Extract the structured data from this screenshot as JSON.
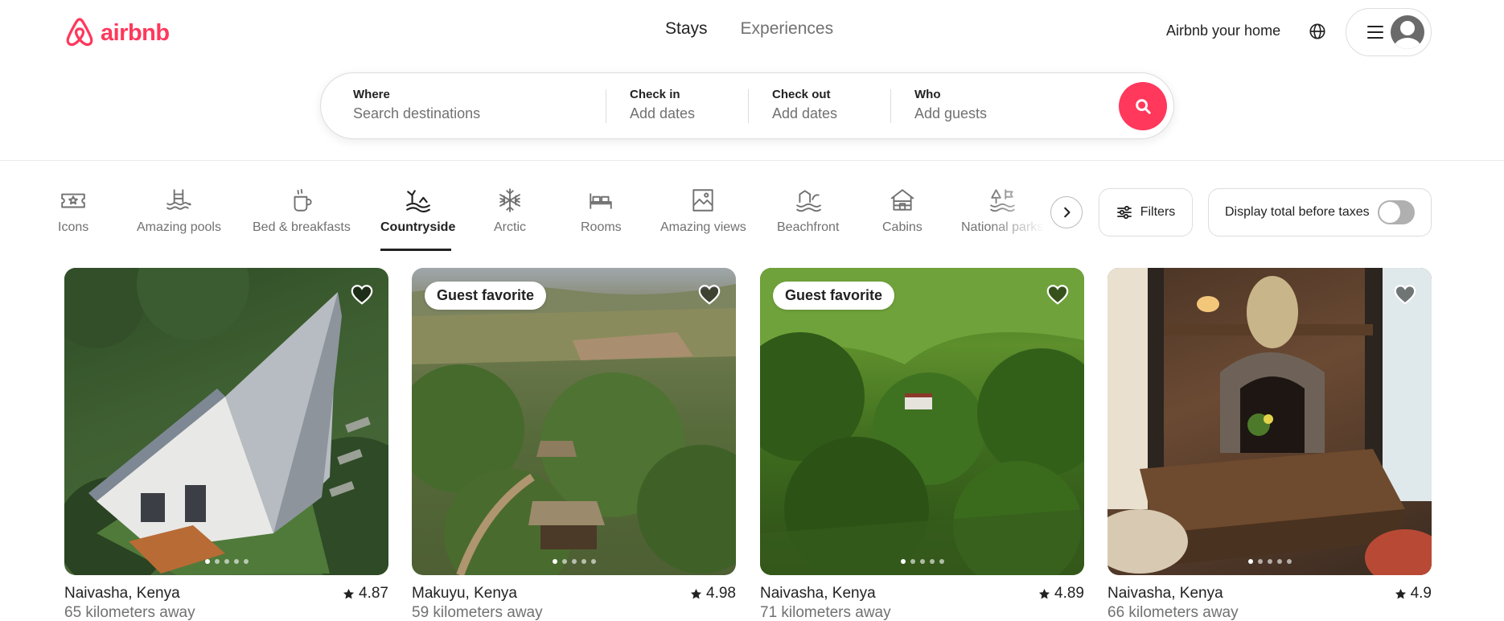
{
  "brand": {
    "name": "airbnb",
    "color": "#FF385C"
  },
  "nav": {
    "tabs": [
      {
        "label": "Stays",
        "active": true
      },
      {
        "label": "Experiences",
        "active": false
      }
    ],
    "host_link": "Airbnb your home",
    "globe_icon": "globe-icon",
    "menu_icon": "hamburger-menu-icon",
    "avatar_icon": "user-avatar-icon"
  },
  "search": {
    "where": {
      "label": "Where",
      "placeholder": "Search destinations"
    },
    "check_in": {
      "label": "Check in",
      "value": "Add dates"
    },
    "check_out": {
      "label": "Check out",
      "value": "Add dates"
    },
    "who": {
      "label": "Who",
      "value": "Add guests"
    },
    "button_icon": "search-icon"
  },
  "categories": [
    {
      "label": "Icons",
      "icon": "ticket-icon",
      "active": false
    },
    {
      "label": "Amazing pools",
      "icon": "pool-icon",
      "active": false
    },
    {
      "label": "Bed & breakfasts",
      "icon": "coffee-icon",
      "active": false
    },
    {
      "label": "Countryside",
      "icon": "countryside-icon",
      "active": true
    },
    {
      "label": "Arctic",
      "icon": "snowflake-icon",
      "active": false
    },
    {
      "label": "Rooms",
      "icon": "bed-icon",
      "active": false
    },
    {
      "label": "Amazing views",
      "icon": "view-icon",
      "active": false
    },
    {
      "label": "Beachfront",
      "icon": "beach-icon",
      "active": false
    },
    {
      "label": "Cabins",
      "icon": "cabin-icon",
      "active": false
    },
    {
      "label": "National parks",
      "icon": "national-park-icon",
      "active": false
    }
  ],
  "filters": {
    "label": "Filters",
    "icon": "filters-icon"
  },
  "taxes_toggle": {
    "label": "Display total before taxes",
    "on": false
  },
  "listings": [
    {
      "location": "Naivasha, Kenya",
      "rating": "4.87",
      "distance": "65 kilometers away",
      "badge": "",
      "photo_count": 5,
      "photo_index": 0
    },
    {
      "location": "Makuyu, Kenya",
      "rating": "4.98",
      "distance": "59 kilometers away",
      "badge": "Guest favorite",
      "photo_count": 5,
      "photo_index": 0
    },
    {
      "location": "Naivasha, Kenya",
      "rating": "4.89",
      "distance": "71 kilometers away",
      "badge": "Guest favorite",
      "photo_count": 5,
      "photo_index": 0
    },
    {
      "location": "Naivasha, Kenya",
      "rating": "4.9",
      "distance": "66 kilometers away",
      "badge": "",
      "photo_count": 5,
      "photo_index": 0
    }
  ]
}
